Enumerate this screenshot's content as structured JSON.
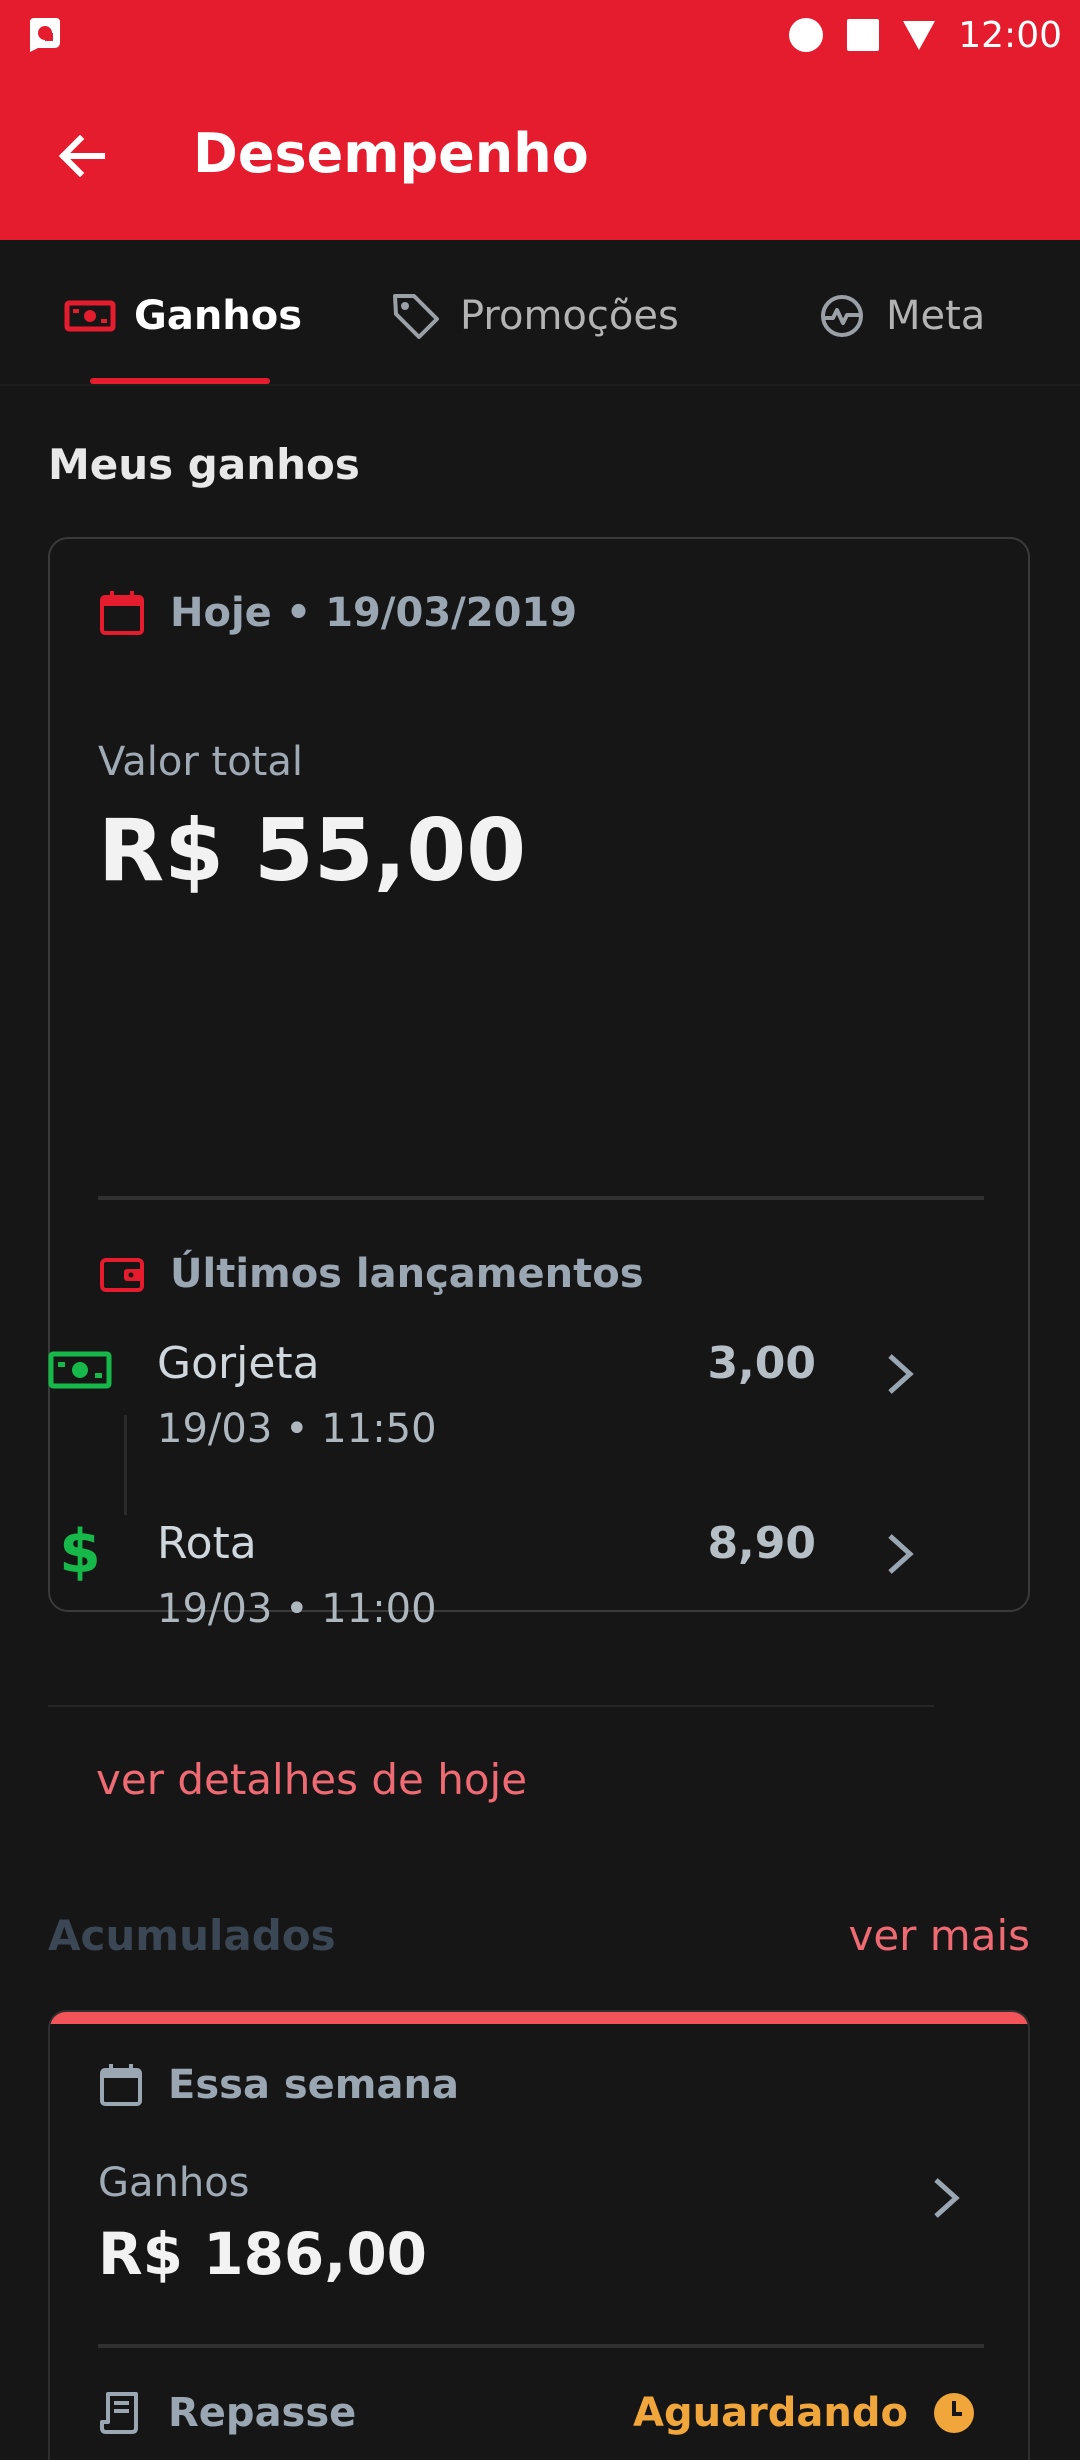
{
  "status_bar": {
    "time": "12:00"
  },
  "app_bar": {
    "title": "Desempenho"
  },
  "tabs": [
    {
      "label": "Ganhos",
      "icon": "money-icon",
      "active": true
    },
    {
      "label": "Promoções",
      "icon": "tag-icon",
      "active": false
    },
    {
      "label": "Meta",
      "icon": "pulse-icon",
      "active": false
    }
  ],
  "section_title": "Meus ganhos",
  "today_card": {
    "date_label": "Hoje • 19/03/2019",
    "total_label": "Valor total",
    "total_value": "R$ 55,00",
    "recent_label": "Últimos lançamentos",
    "entries": [
      {
        "name": "Gorjeta",
        "datetime": "19/03 • 11:50",
        "value": "3,00",
        "icon": "cash-icon"
      },
      {
        "name": "Rota",
        "datetime": "19/03 • 11:00",
        "value": "8,90",
        "icon": "dollar-icon"
      }
    ],
    "details_link": "ver detalhes de hoje"
  },
  "accumulated": {
    "title": "Acumulados",
    "more_link": "ver mais"
  },
  "week_card": {
    "period_label": "Essa semana",
    "earnings_label": "Ganhos",
    "earnings_value": "R$ 186,00",
    "transfer_label": "Repasse",
    "transfer_status": "Aguardando"
  },
  "colors": {
    "brand_red": "#e51b2e",
    "background": "#161616",
    "link": "#f06a73",
    "success_green": "#17b84a",
    "pending_orange": "#f0a63a"
  }
}
